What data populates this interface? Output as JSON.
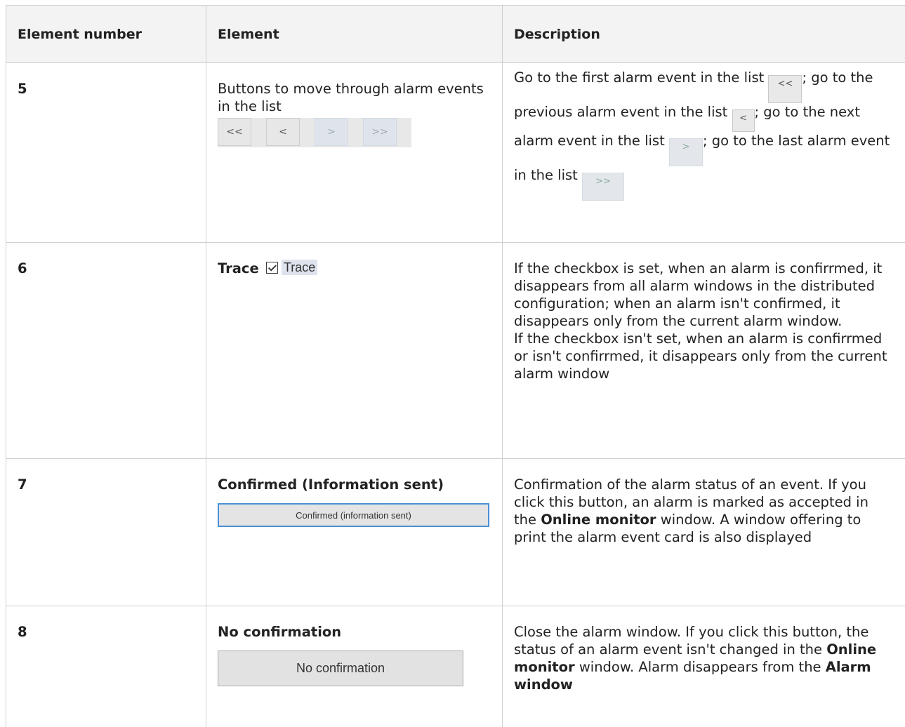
{
  "headers": {
    "col1": "Element number",
    "col2": "Element",
    "col3": "Description"
  },
  "rows": [
    {
      "number": "5",
      "element": "Buttons to move through alarm events in the list",
      "nav_buttons": [
        "<<",
        "<",
        ">",
        ">>"
      ],
      "description": {
        "part1": "Go to the first alarm event in the list",
        "part2": "; go to the previous alarm event in the list",
        "part3": "; go to the next alarm event in the list",
        "part4": "; go to the last alarm event in the list",
        "btn_first": "<<",
        "btn_prev": "<",
        "btn_next": ">",
        "btn_last": ">>"
      }
    },
    {
      "number": "6",
      "element": "Trace",
      "checkbox_label": "Trace",
      "checkbox_checked": true,
      "description": {
        "para1": "If the checkbox is set, when an alarm is confirrmed, it disappears from all alarm windows in the distributed configuration; when an alarm isn't confirmed, it disappears only from the current alarm window.",
        "para2": "If the checkbox isn't set, when an alarm is confirrmed or isn't confirrmed, it disappears only from the current alarm window"
      }
    },
    {
      "number": "7",
      "element": "Confirmed (Information sent)",
      "button_label": "Confirmed (information sent)",
      "description": {
        "text1": "Confirmation of the alarm status of an event. If you click this button, an alarm is marked as accepted in the ",
        "bold1": "Online monitor",
        "text2": " window. A window offering to print the alarm event card is also displayed"
      }
    },
    {
      "number": "8",
      "element": "No confirmation",
      "button_label": "No confirmation",
      "description": {
        "text1": "Close the alarm window. If you click this button, the status of an alarm event isn't changed in the ",
        "bold1": "Online monitor",
        "text2": " window. Alarm disappears from the ",
        "bold2": "Alarm window"
      }
    }
  ]
}
